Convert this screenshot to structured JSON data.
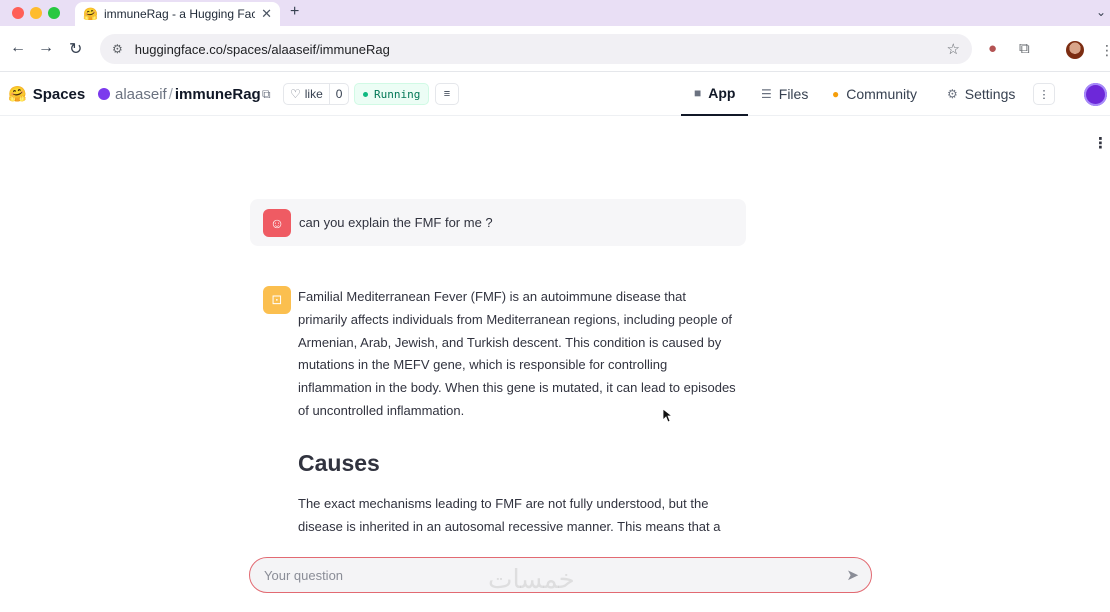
{
  "browser": {
    "tab_title": "immuneRag - a Hugging Face",
    "tab_favicon": "🤗",
    "url": "huggingface.co/spaces/alaaseif/immuneRag"
  },
  "hf": {
    "brand": "Spaces",
    "brand_emoji": "🤗",
    "owner": "alaaseif",
    "separator": "/",
    "repo": "immuneRag",
    "like_label": "like",
    "like_count": "0",
    "status": "Running",
    "tabs": [
      {
        "label": "App",
        "icon": "cube-icon",
        "active": true
      },
      {
        "label": "Files",
        "icon": "files-icon",
        "active": false
      },
      {
        "label": "Community",
        "icon": "community-icon",
        "active": false
      },
      {
        "label": "Settings",
        "icon": "gear-icon",
        "active": false
      }
    ]
  },
  "chat": {
    "user_message": "can you explain the FMF for me ?",
    "assistant_paragraph_1": "Familial Mediterranean Fever (FMF) is an autoimmune disease that primarily affects individuals from Mediterranean regions, including people of Armenian, Arab, Jewish, and Turkish descent. This condition is caused by mutations in the MEFV gene, which is responsible for controlling inflammation in the body. When this gene is mutated, it can lead to episodes of uncontrolled inflammation.",
    "assistant_heading": "Causes",
    "assistant_paragraph_2": "The exact mechanisms leading to FMF are not fully understood, but the disease is inherited in an autosomal recessive manner. This means that a person needs to inherit two copies of the mutated gene (one from each parent) to develop the disease.",
    "input_placeholder": "Your question"
  },
  "watermark": "خمسات",
  "colors": {
    "accent_user": "#ef5b63",
    "accent_bot": "#fbbf4f",
    "running": "#047857",
    "input_border": "#e26a72"
  }
}
